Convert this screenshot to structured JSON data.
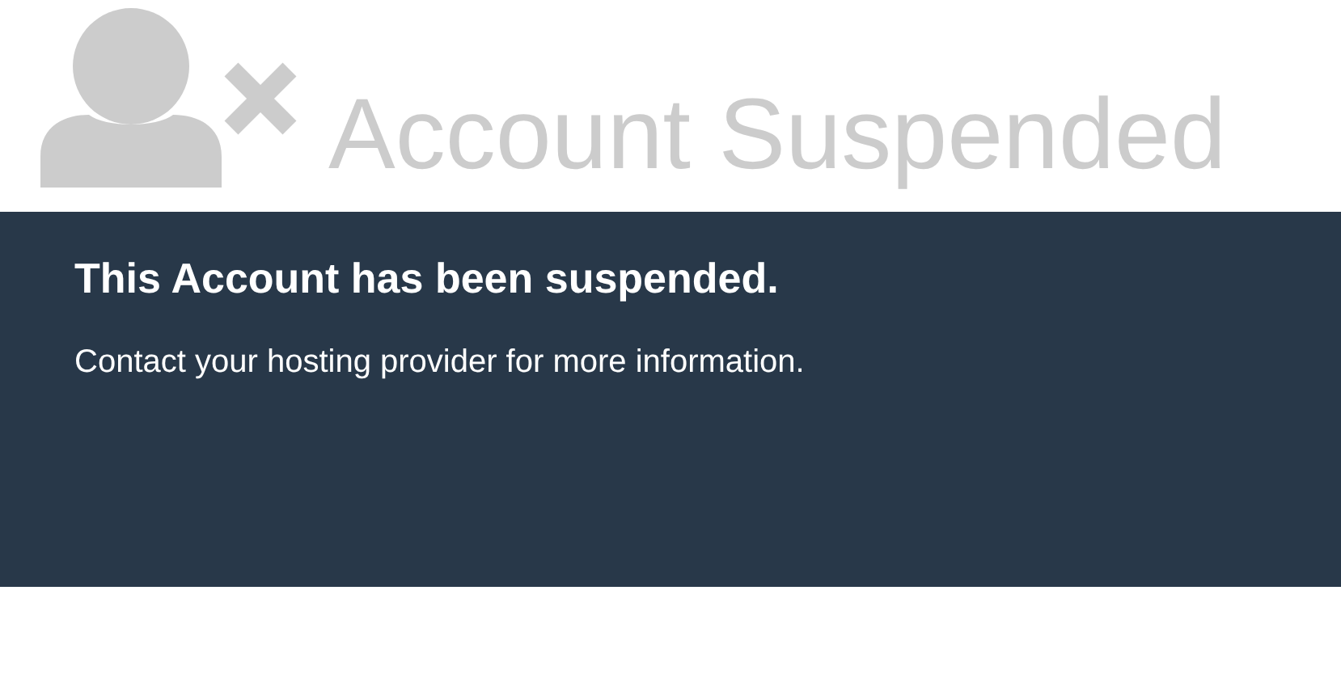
{
  "header": {
    "title": "Account Suspended"
  },
  "message": {
    "heading": "This Account has been suspended.",
    "body": "Contact your hosting provider for more information."
  }
}
